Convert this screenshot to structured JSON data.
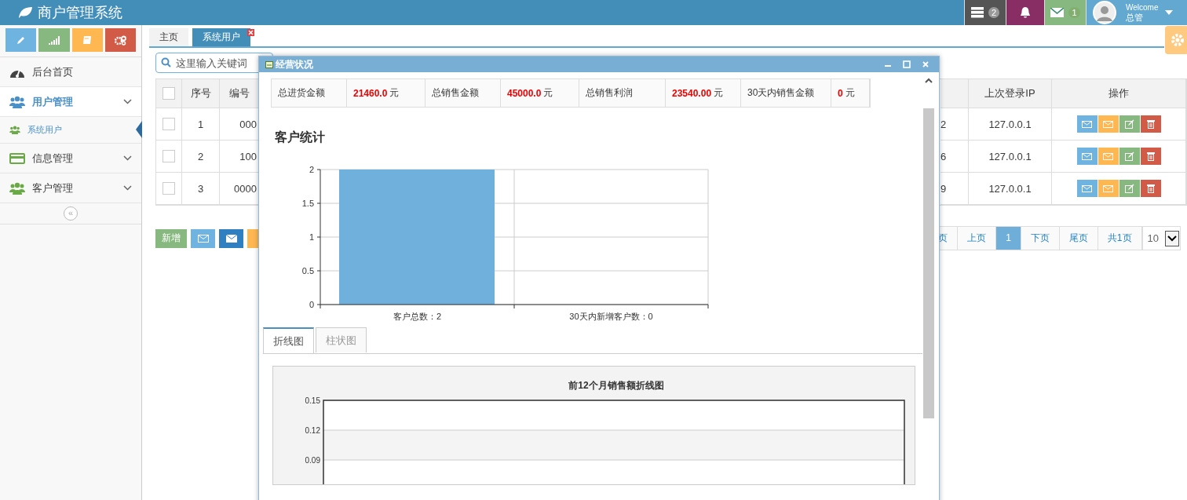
{
  "header": {
    "title": "商户管理系统",
    "tasks_badge": "2",
    "messages_badge": "1",
    "greeting": "Welcome",
    "user_name": "总管"
  },
  "sidebar": {
    "shortcuts": [
      {
        "kind": "pencil",
        "color": "#6fb3e0"
      },
      {
        "kind": "signal",
        "color": "#87b87f"
      },
      {
        "kind": "book",
        "color": "#ffb752"
      },
      {
        "kind": "cogs",
        "color": "#d15b47"
      }
    ],
    "menu": [
      {
        "kind": "dashboard",
        "label": "后台首页",
        "selected": false
      },
      {
        "kind": "users",
        "label": "用户管理",
        "selected": true,
        "children": [
          {
            "label": "系统用户",
            "selected": true
          }
        ]
      },
      {
        "kind": "card",
        "label": "信息管理",
        "selected": false
      },
      {
        "kind": "users",
        "label": "客户管理",
        "selected": false
      }
    ],
    "collapse_label": "«"
  },
  "tabs": [
    {
      "label": "主页",
      "selected": false,
      "closable": false
    },
    {
      "label": "系统用户",
      "selected": true,
      "closable": true
    }
  ],
  "search": {
    "placeholder": "这里输入关键词"
  },
  "table": {
    "all_selected": false,
    "columns": {
      "index": "序号",
      "code": "编号",
      "last_ip": "上次登录IP",
      "actions": "操作"
    },
    "rows": [
      {
        "selected": false,
        "index": "1",
        "code": "000",
        "column_4": "2",
        "last_ip": "127.0.0.1"
      },
      {
        "selected": false,
        "index": "2",
        "code": "100",
        "column_4": "6",
        "last_ip": "127.0.0.1"
      },
      {
        "selected": false,
        "index": "3",
        "code": "0000",
        "column_4": "9",
        "last_ip": "127.0.0.1"
      }
    ]
  },
  "toolbar": {
    "add_label": "新增"
  },
  "pagination": {
    "pages": [
      {
        "label": "页",
        "selected": false
      },
      {
        "label": "上页",
        "selected": false
      },
      {
        "label": "1",
        "selected": true
      },
      {
        "label": "下页",
        "selected": false
      },
      {
        "label": "尾页",
        "selected": false
      },
      {
        "label": "共1页",
        "selected": false
      }
    ],
    "page_size": "10"
  },
  "dialog": {
    "title": "经营状况",
    "stats": [
      {
        "label": "总进货金额",
        "value": "21460.0",
        "unit": "元"
      },
      {
        "label": "总销售金额",
        "value": "45000.0",
        "unit": "元"
      },
      {
        "label": "总销售利润",
        "value": "23540.00",
        "unit": "元"
      },
      {
        "label": "30天内销售金额",
        "value": "0",
        "unit": "元"
      }
    ],
    "section_title": "客户统计",
    "chart_data": {
      "type": "bar",
      "categories": [
        "客户总数：2",
        "30天内新增客户数：0"
      ],
      "values": [
        2,
        0
      ],
      "ylim": [
        0,
        2
      ],
      "yticks": [
        0,
        0.5,
        1,
        1.5,
        2
      ],
      "grid": true
    },
    "chart_tabs": [
      {
        "label": "折线图",
        "selected": true
      },
      {
        "label": "柱状图",
        "selected": false
      }
    ],
    "line_chart": {
      "title": "前12个月销售额折线图",
      "ytick_labels": [
        "0.15",
        "0.12",
        "0.09"
      ]
    }
  }
}
